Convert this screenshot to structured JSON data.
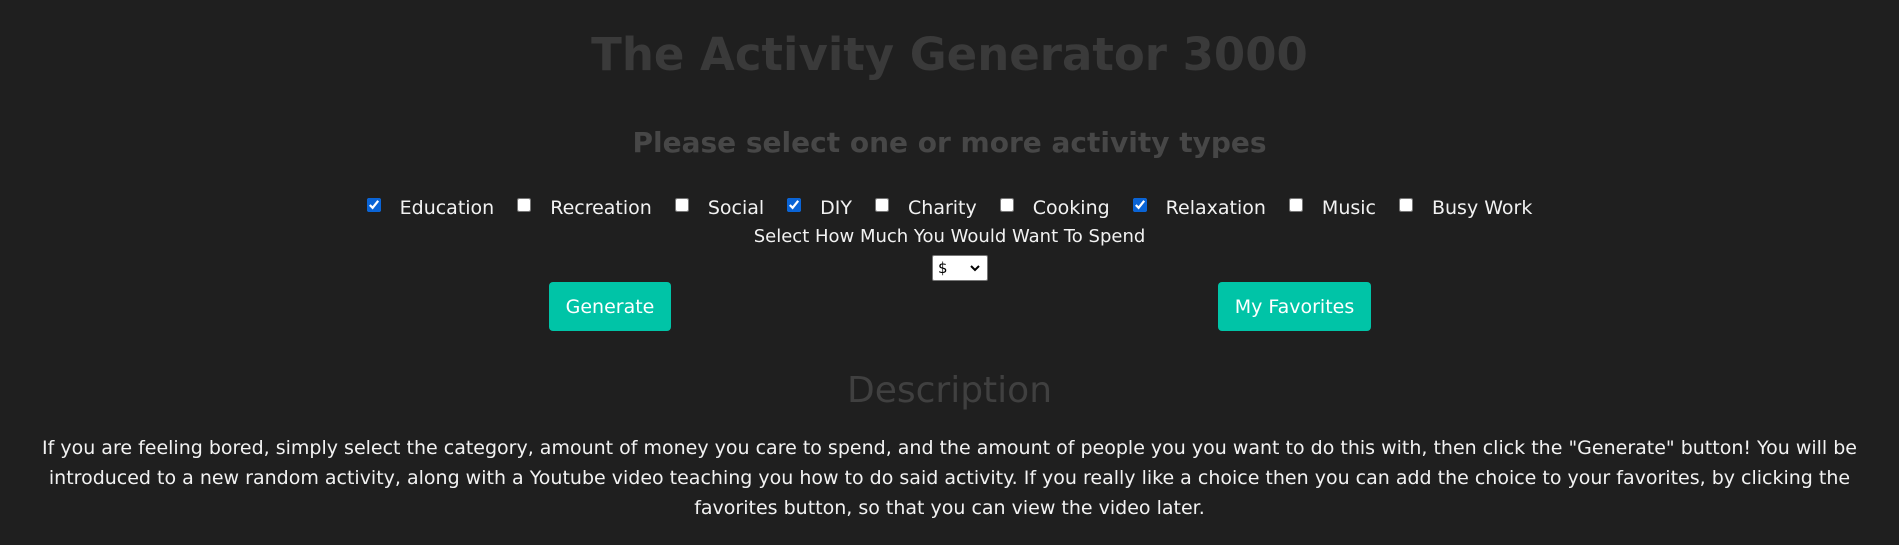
{
  "header": {
    "title": "The Activity Generator 3000",
    "subtitle": "Please select one or more activity types"
  },
  "activity_types": [
    {
      "label": "Education",
      "checked": true
    },
    {
      "label": "Recreation",
      "checked": false
    },
    {
      "label": "Social",
      "checked": false
    },
    {
      "label": "DIY",
      "checked": true
    },
    {
      "label": "Charity",
      "checked": false
    },
    {
      "label": "Cooking",
      "checked": false
    },
    {
      "label": "Relaxation",
      "checked": true
    },
    {
      "label": "Music",
      "checked": false
    },
    {
      "label": "Busy Work",
      "checked": false
    }
  ],
  "spend": {
    "label": "Select How Much You Would Want To Spend",
    "selected": "$"
  },
  "buttons": {
    "generate_label": "Generate",
    "favorites_label": "My Favorites"
  },
  "description": {
    "title": "Description",
    "text": "If you are feeling bored, simply select the category, amount of money you care to spend, and the amount of people you you want to do this with, then click the \"Generate\" button! You will be introduced to a new random activity, along with a Youtube video teaching you how to do said activity. If you really like a choice then you can add the choice to your favorites, by clicking the favorites button, so that you can view the video later."
  },
  "colors": {
    "background": "#1f1f1f",
    "accent": "#00c4a7",
    "checkbox": "#0a64d6"
  },
  "icons": {
    "select_chevron": "chevron-down-icon"
  }
}
